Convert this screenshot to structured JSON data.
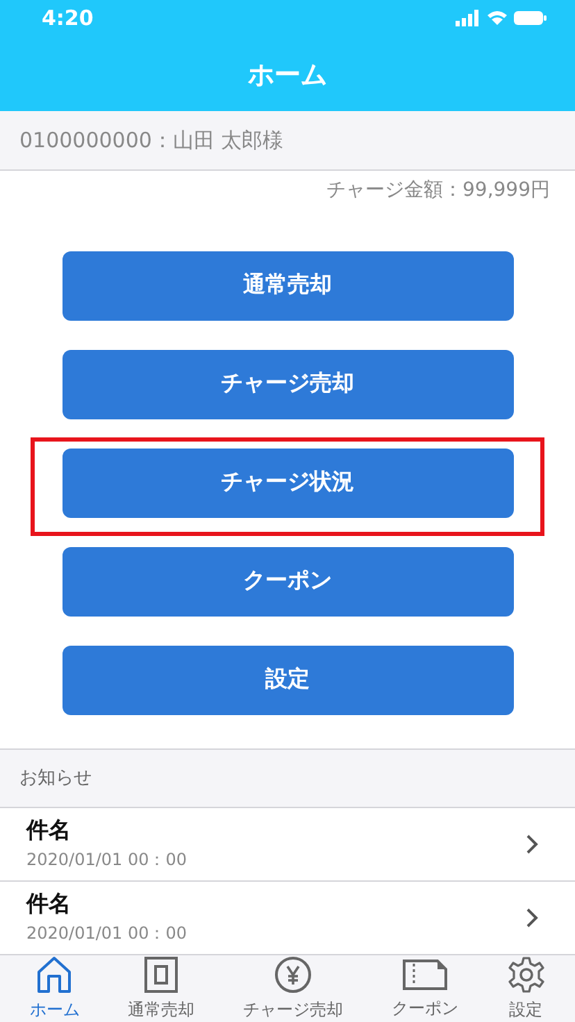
{
  "status_bar": {
    "time": "4:20"
  },
  "header": {
    "title": "ホーム"
  },
  "account": {
    "text": "0100000000：山田 太郎様"
  },
  "balance": {
    "text": "チャージ金額：99,999円"
  },
  "menu_buttons": [
    {
      "label": "通常売却",
      "highlighted": false
    },
    {
      "label": "チャージ売却",
      "highlighted": false
    },
    {
      "label": "チャージ状況",
      "highlighted": true
    },
    {
      "label": "クーポン",
      "highlighted": false
    },
    {
      "label": "設定",
      "highlighted": false
    }
  ],
  "news": {
    "heading": "お知らせ",
    "items": [
      {
        "title": "件名",
        "date": "2020/01/01 00：00"
      },
      {
        "title": "件名",
        "date": "2020/01/01 00：00"
      }
    ]
  },
  "tab_bar": [
    {
      "kind": "home",
      "label": "ホーム",
      "selected": true
    },
    {
      "kind": "sale",
      "label": "通常売却",
      "selected": false
    },
    {
      "kind": "yen",
      "label": "チャージ売却",
      "selected": false
    },
    {
      "kind": "coupon",
      "label": "クーポン",
      "selected": false
    },
    {
      "kind": "settings",
      "label": "設定",
      "selected": false
    }
  ]
}
